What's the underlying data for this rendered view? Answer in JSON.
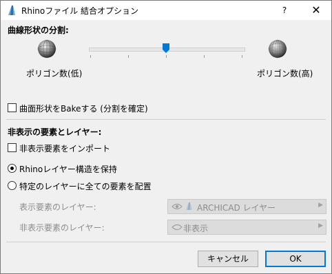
{
  "window": {
    "title": "Rhinoファイル 結合オプション",
    "help": "?",
    "close": "✕"
  },
  "subdivision": {
    "heading": "曲線形状の分割:",
    "low_label": "ポリゴン数(低)",
    "high_label": "ポリゴン数(高)",
    "slider_level": 0.5
  },
  "bake": {
    "label": "曲面形状をBakeする (分割を確定)",
    "checked": false
  },
  "hidden_section": {
    "heading": "非表示の要素とレイヤー:",
    "import_label": "非表示要素をインポート",
    "import_checked": false,
    "radio_keep": "Rhinoレイヤー構造を保持",
    "radio_keep_selected": true,
    "radio_place": "特定のレイヤーに全ての要素を配置",
    "radio_place_selected": false,
    "visible_layer_label": "表示要素のレイヤー:",
    "visible_layer_value": "ARCHICAD レイヤー",
    "hidden_layer_label": "非表示要素のレイヤー:",
    "hidden_layer_value": "非表示"
  },
  "buttons": {
    "cancel": "キャンセル",
    "ok": "OK"
  },
  "colors": {
    "accent": "#0078d7",
    "dialog_bg": "#f0f0f0"
  }
}
